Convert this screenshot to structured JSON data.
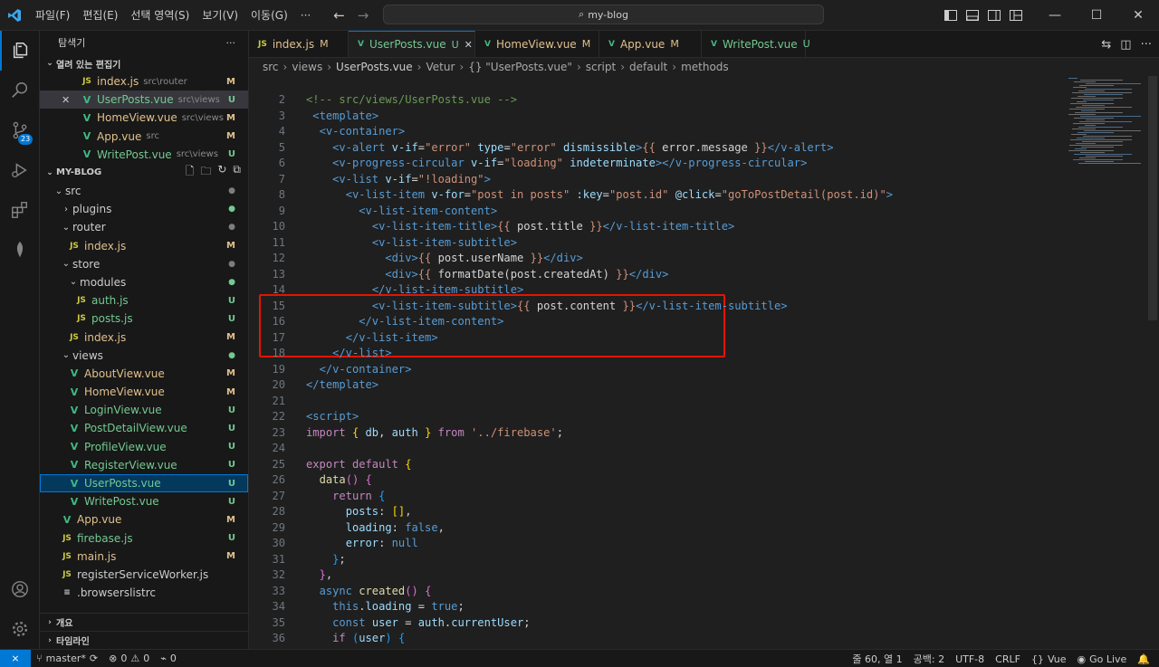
{
  "titlebar": {
    "menu": [
      "파일(F)",
      "편집(E)",
      "선택 영역(S)",
      "보기(V)",
      "이동(G)",
      "···"
    ],
    "search_text": "my-blog"
  },
  "activity": {
    "scm_badge": "23"
  },
  "sidebar": {
    "title": "탐색기",
    "more": "···",
    "open_editors_label": "열려 있는 편집기",
    "open_editors": [
      {
        "icon": "JS",
        "kind": "js",
        "name": "index.js",
        "desc": "src\\router",
        "status": "M"
      },
      {
        "icon": "V",
        "kind": "vue",
        "name": "UserPosts.vue",
        "desc": "src\\views",
        "status": "U",
        "close": "✕"
      },
      {
        "icon": "V",
        "kind": "vue",
        "name": "HomeView.vue",
        "desc": "src\\views",
        "status": "M"
      },
      {
        "icon": "V",
        "kind": "vue",
        "name": "App.vue",
        "desc": "src",
        "status": "M"
      },
      {
        "icon": "V",
        "kind": "vue",
        "name": "WritePost.vue",
        "desc": "src\\views",
        "status": "U"
      }
    ],
    "project_label": "MY-BLOG",
    "tree": [
      {
        "chev": "⌄",
        "name": "src",
        "status": "●"
      },
      {
        "chev": "›",
        "name": "plugins",
        "status": "●"
      },
      {
        "chev": "⌄",
        "name": "router",
        "status": "●"
      },
      {
        "icon": "JS",
        "kind": "js",
        "name": "index.js",
        "status": "M"
      },
      {
        "chev": "⌄",
        "name": "store",
        "status": "●"
      },
      {
        "chev": "⌄",
        "name": "modules",
        "status": "●"
      },
      {
        "icon": "JS",
        "kind": "js",
        "name": "auth.js",
        "status": "U"
      },
      {
        "icon": "JS",
        "kind": "js",
        "name": "posts.js",
        "status": "U"
      },
      {
        "icon": "JS",
        "kind": "js",
        "name": "index.js",
        "status": "M"
      },
      {
        "chev": "⌄",
        "name": "views",
        "status": "●"
      },
      {
        "icon": "V",
        "kind": "vue",
        "name": "AboutView.vue",
        "status": "M"
      },
      {
        "icon": "V",
        "kind": "vue",
        "name": "HomeView.vue",
        "status": "M"
      },
      {
        "icon": "V",
        "kind": "vue",
        "name": "LoginView.vue",
        "status": "U"
      },
      {
        "icon": "V",
        "kind": "vue",
        "name": "PostDetailView.vue",
        "status": "U"
      },
      {
        "icon": "V",
        "kind": "vue",
        "name": "ProfileView.vue",
        "status": "U"
      },
      {
        "icon": "V",
        "kind": "vue",
        "name": "RegisterView.vue",
        "status": "U"
      },
      {
        "icon": "V",
        "kind": "vue",
        "name": "UserPosts.vue",
        "status": "U"
      },
      {
        "icon": "V",
        "kind": "vue",
        "name": "WritePost.vue",
        "status": "U"
      },
      {
        "icon": "V",
        "kind": "vue",
        "name": "App.vue",
        "status": "M"
      },
      {
        "icon": "JS",
        "kind": "js",
        "name": "firebase.js",
        "status": "U"
      },
      {
        "icon": "JS",
        "kind": "js",
        "name": "main.js",
        "status": "M"
      },
      {
        "icon": "JS",
        "kind": "js",
        "name": "registerServiceWorker.js",
        "status": ""
      },
      {
        "icon": "≡",
        "kind": "cfg",
        "name": ".browserslistrc",
        "status": ""
      }
    ],
    "outline_label": "개요",
    "timeline_label": "타임라인"
  },
  "tabs": [
    {
      "icon": "JS",
      "kind": "js",
      "name": "index.js",
      "mark": "M"
    },
    {
      "icon": "V",
      "kind": "vue",
      "name": "UserPosts.vue",
      "mark": "U",
      "close": "✕"
    },
    {
      "icon": "V",
      "kind": "vue",
      "name": "HomeView.vue",
      "mark": "M"
    },
    {
      "icon": "V",
      "kind": "vue",
      "name": "App.vue",
      "mark": "M"
    },
    {
      "icon": "V",
      "kind": "vue",
      "name": "WritePost.vue",
      "mark": "U"
    }
  ],
  "breadcrumbs": {
    "items": [
      "src",
      "views",
      "UserPosts.vue",
      "Vetur",
      "{} \"UserPosts.vue\"",
      "script",
      "default",
      "methods"
    ]
  },
  "code": {
    "lines": [
      [
        [
          "com",
          "<!-- src/views/UserPosts.vue -->"
        ]
      ],
      [
        [
          "txt",
          " "
        ],
        [
          "tag",
          "<"
        ],
        [
          "txt",
          "template"
        ],
        [
          "tag",
          ">"
        ]
      ],
      [
        [
          "txt",
          "  "
        ],
        [
          "tag",
          "<v-container>"
        ]
      ],
      [
        [
          "txt",
          "    "
        ],
        [
          "tag",
          "<v-alert "
        ],
        [
          "attr",
          "v-if"
        ],
        [
          "txt",
          "="
        ],
        [
          "str",
          "\"error\""
        ],
        [
          "txt",
          " "
        ],
        [
          "attr",
          "type"
        ],
        [
          "txt",
          "="
        ],
        [
          "str",
          "\"error\""
        ],
        [
          "txt",
          " "
        ],
        [
          "attr",
          "dismissible"
        ],
        [
          "tag",
          ">"
        ],
        [
          "str",
          "{{"
        ],
        [
          "txt",
          " error.message "
        ],
        [
          "str",
          "}}"
        ],
        [
          "tag",
          "</v-alert>"
        ]
      ],
      [
        [
          "txt",
          "    "
        ],
        [
          "tag",
          "<v-progress-circular "
        ],
        [
          "attr",
          "v-if"
        ],
        [
          "txt",
          "="
        ],
        [
          "str",
          "\"loading\""
        ],
        [
          "txt",
          " "
        ],
        [
          "attr",
          "indeterminate"
        ],
        [
          "tag",
          "></v-progress-circular>"
        ]
      ],
      [
        [
          "txt",
          "    "
        ],
        [
          "tag",
          "<v-list "
        ],
        [
          "attr",
          "v-if"
        ],
        [
          "txt",
          "="
        ],
        [
          "str",
          "\"!loading\""
        ],
        [
          "tag",
          ">"
        ]
      ],
      [
        [
          "txt",
          "      "
        ],
        [
          "tag",
          "<v-list-item "
        ],
        [
          "attr",
          "v-for"
        ],
        [
          "txt",
          "="
        ],
        [
          "str",
          "\"post in posts\""
        ],
        [
          "txt",
          " "
        ],
        [
          "attr",
          ":key"
        ],
        [
          "txt",
          "="
        ],
        [
          "str",
          "\"post.id\""
        ],
        [
          "txt",
          " "
        ],
        [
          "attr",
          "@click"
        ],
        [
          "txt",
          "="
        ],
        [
          "str",
          "\"goToPostDetail(post.id)\""
        ],
        [
          "tag",
          ">"
        ]
      ],
      [
        [
          "txt",
          "        "
        ],
        [
          "tag",
          "<v-list-item-content>"
        ]
      ],
      [
        [
          "txt",
          "          "
        ],
        [
          "tag",
          "<v-list-item-title>"
        ],
        [
          "str",
          "{{"
        ],
        [
          "txt",
          " post.title "
        ],
        [
          "str",
          "}}"
        ],
        [
          "tag",
          "</v-list-item-title>"
        ]
      ],
      [
        [
          "txt",
          "          "
        ],
        [
          "tag",
          "<v-list-item-subtitle>"
        ]
      ],
      [
        [
          "txt",
          "            "
        ],
        [
          "tag",
          "<div>"
        ],
        [
          "str",
          "{{"
        ],
        [
          "txt",
          " post.userName "
        ],
        [
          "str",
          "}}"
        ],
        [
          "tag",
          "</div>"
        ]
      ],
      [
        [
          "txt",
          "            "
        ],
        [
          "tag",
          "<div>"
        ],
        [
          "str",
          "{{"
        ],
        [
          "txt",
          " formatDate(post.createdAt) "
        ],
        [
          "str",
          "}}"
        ],
        [
          "tag",
          "</div>"
        ]
      ],
      [
        [
          "txt",
          "          "
        ],
        [
          "tag",
          "</v-list-item-subtitle>"
        ]
      ],
      [
        [
          "txt",
          "          "
        ],
        [
          "tag",
          "<v-list-item-subtitle>"
        ],
        [
          "str",
          "{{"
        ],
        [
          "txt",
          " post.content "
        ],
        [
          "str",
          "}}"
        ],
        [
          "tag",
          "</v-list-item-subtitle>"
        ]
      ],
      [
        [
          "txt",
          "        "
        ],
        [
          "tag",
          "</v-list-item-content>"
        ]
      ],
      [
        [
          "txt",
          "      "
        ],
        [
          "tag",
          "</v-list-item>"
        ]
      ],
      [
        [
          "txt",
          "    "
        ],
        [
          "tag",
          "</v-list>"
        ]
      ],
      [
        [
          "txt",
          "  "
        ],
        [
          "tag",
          "</v-container>"
        ]
      ],
      [
        [
          "txt",
          "</template>"
        ]
      ],
      [
        [
          "txt",
          ""
        ]
      ],
      [
        [
          "txt",
          "<script>"
        ]
      ],
      [
        [
          "kw",
          "import"
        ],
        [
          "txt",
          " "
        ],
        [
          "br",
          "{"
        ],
        [
          "txt",
          " "
        ],
        [
          "var",
          "db"
        ],
        [
          "txt",
          ", "
        ],
        [
          "var",
          "auth"
        ],
        [
          "txt",
          " "
        ],
        [
          "br",
          "}"
        ],
        [
          "txt",
          " "
        ],
        [
          "kw",
          "from"
        ],
        [
          "txt",
          " "
        ],
        [
          "str",
          "'../firebase'"
        ],
        [
          "txt",
          ";"
        ]
      ],
      [
        [
          "txt",
          ""
        ]
      ],
      [
        [
          "kw",
          "export"
        ],
        [
          "txt",
          " "
        ],
        [
          "kw",
          "default"
        ],
        [
          "txt",
          " "
        ],
        [
          "br",
          "{"
        ]
      ],
      [
        [
          "txt",
          "  "
        ],
        [
          "fn",
          "data"
        ],
        [
          "br2",
          "()"
        ],
        [
          "txt",
          " "
        ],
        [
          "br2",
          "{"
        ]
      ],
      [
        [
          "txt",
          "    "
        ],
        [
          "kw",
          "return"
        ],
        [
          "txt",
          " "
        ],
        [
          "br3",
          "{"
        ]
      ],
      [
        [
          "txt",
          "      "
        ],
        [
          "var",
          "posts"
        ],
        [
          "txt",
          ": "
        ],
        [
          "br",
          "[]"
        ],
        [
          "txt",
          ","
        ]
      ],
      [
        [
          "txt",
          "      "
        ],
        [
          "var",
          "loading"
        ],
        [
          "txt",
          ": "
        ],
        [
          "kwb",
          "false"
        ],
        [
          "txt",
          ","
        ]
      ],
      [
        [
          "txt",
          "      "
        ],
        [
          "var",
          "error"
        ],
        [
          "txt",
          ": "
        ],
        [
          "kwb",
          "null"
        ]
      ],
      [
        [
          "txt",
          "    "
        ],
        [
          "br3",
          "}"
        ],
        [
          "txt",
          ";"
        ]
      ],
      [
        [
          "txt",
          "  "
        ],
        [
          "br2",
          "}"
        ],
        [
          "txt",
          ","
        ]
      ],
      [
        [
          "txt",
          "  "
        ],
        [
          "kwb",
          "async"
        ],
        [
          "txt",
          " "
        ],
        [
          "fn",
          "created"
        ],
        [
          "br2",
          "()"
        ],
        [
          "txt",
          " "
        ],
        [
          "br2",
          "{"
        ]
      ],
      [
        [
          "txt",
          "    "
        ],
        [
          "kwb",
          "this"
        ],
        [
          "txt",
          "."
        ],
        [
          "var",
          "loading"
        ],
        [
          "txt",
          " = "
        ],
        [
          "kwb",
          "true"
        ],
        [
          "txt",
          ";"
        ]
      ],
      [
        [
          "txt",
          "    "
        ],
        [
          "kwb",
          "const"
        ],
        [
          "txt",
          " "
        ],
        [
          "var",
          "user"
        ],
        [
          "txt",
          " = "
        ],
        [
          "var",
          "auth"
        ],
        [
          "txt",
          "."
        ],
        [
          "var",
          "currentUser"
        ],
        [
          "txt",
          ";"
        ]
      ],
      [
        [
          "txt",
          "    "
        ],
        [
          "kw",
          "if"
        ],
        [
          "txt",
          " "
        ],
        [
          "br3",
          "("
        ],
        [
          "var",
          "user"
        ],
        [
          "br3",
          ")"
        ],
        [
          "txt",
          " "
        ],
        [
          "br3",
          "{"
        ]
      ]
    ]
  },
  "statusbar": {
    "branch": "master*",
    "errors": "0",
    "warnings": "0",
    "ports": "0",
    "position": "줄 60, 열 1",
    "spaces": "공백: 2",
    "encoding": "UTF-8",
    "eol": "CRLF",
    "language": "Vue",
    "golive": "Go Live"
  },
  "colors": {
    "accent": "#0078d4",
    "highlight_box": "#e51400",
    "modified": "#e2c08d",
    "untracked": "#73c991"
  }
}
